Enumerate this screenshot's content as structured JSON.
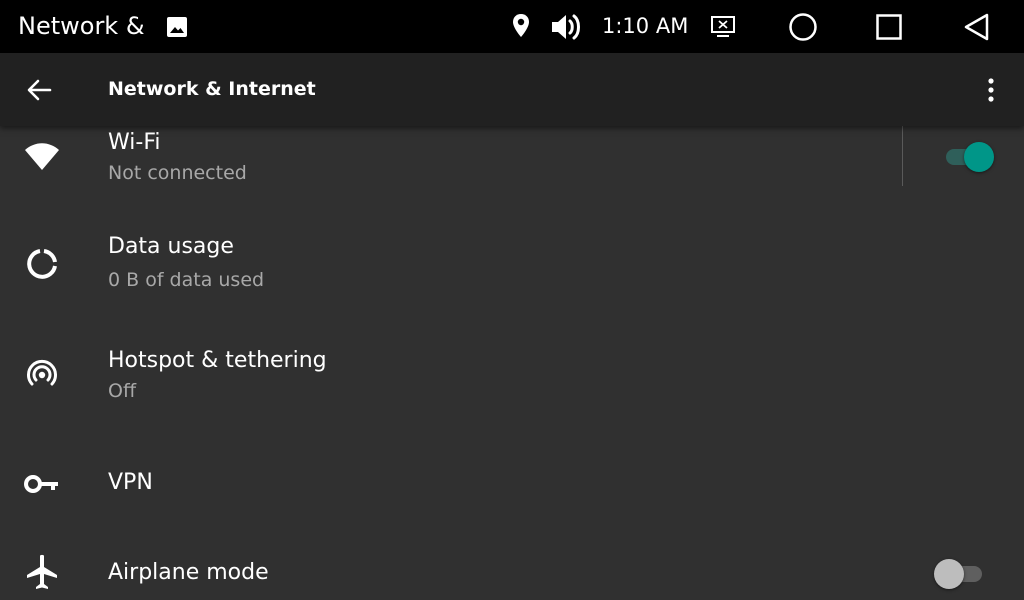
{
  "status_bar": {
    "app_title": "Network &",
    "time": "1:10 AM",
    "icons": [
      "image-icon",
      "location-icon",
      "volume-icon",
      "screen-cast-icon",
      "home-circle-icon",
      "recents-square-icon",
      "back-triangle-icon"
    ]
  },
  "toolbar": {
    "title": "Network & Internet",
    "back_icon": "arrow-back-icon",
    "menu_icon": "more-vert-icon"
  },
  "settings": {
    "wifi": {
      "title": "Wi-Fi",
      "summary": "Not connected",
      "icon": "wifi-icon",
      "enabled": true
    },
    "data_usage": {
      "title": "Data usage",
      "summary": "0 B of data used",
      "icon": "data-usage-icon"
    },
    "hotspot": {
      "title": "Hotspot & tethering",
      "summary": "Off",
      "icon": "hotspot-icon"
    },
    "vpn": {
      "title": "VPN",
      "icon": "vpn-key-icon"
    },
    "airplane": {
      "title": "Airplane mode",
      "icon": "airplane-icon",
      "enabled": false
    }
  },
  "colors": {
    "background": "#303030",
    "toolbar": "#212121",
    "status_bar": "#000000",
    "accent": "#009688",
    "accent_track": "#2f5f5a",
    "secondary_text": "#a8a8a8",
    "switch_off_thumb": "#bdbdbd",
    "switch_off_track": "#5f5f5f"
  }
}
